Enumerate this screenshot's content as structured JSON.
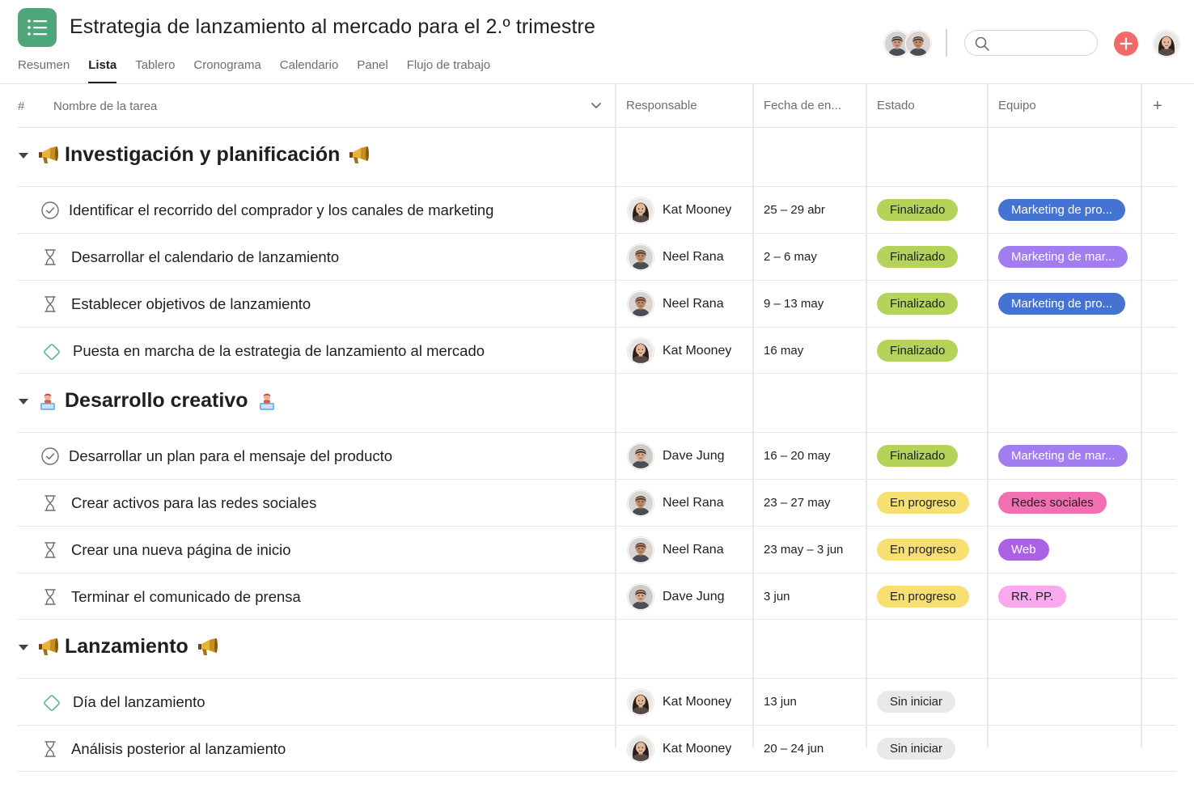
{
  "project": {
    "title": "Estrategia de lanzamiento al mercado para el 2.º trimestre",
    "icon": "list-icon",
    "accent": "#4fa67a"
  },
  "tabs": [
    "Resumen",
    "Lista",
    "Tablero",
    "Cronograma",
    "Calendario",
    "Panel",
    "Flujo de trabajo"
  ],
  "active_tab": "Lista",
  "toolbar": {
    "search_placeholder": "",
    "add_color": "#f06a6a"
  },
  "columns": {
    "number": "#",
    "task": "Nombre de la tarea",
    "assignee": "Responsable",
    "due": "Fecha de en...",
    "status": "Estado",
    "team": "Equipo"
  },
  "colors": {
    "Finalizado": {
      "bg": "#b5d35a",
      "fg": "#1e1f21"
    },
    "En progreso": {
      "bg": "#f8df72",
      "fg": "#1e1f21"
    },
    "Sin iniciar": {
      "bg": "#e9e9e9",
      "fg": "#1e1f21"
    },
    "Marketing de pro...": {
      "bg": "#4573d2",
      "fg": "#ffffff"
    },
    "Marketing de mar...": {
      "bg": "#a17df0",
      "fg": "#ffffff"
    },
    "Redes sociales": {
      "bg": "#f26fb2",
      "fg": "#1e1f21"
    },
    "Web": {
      "bg": "#aa62e3",
      "fg": "#ffffff"
    },
    "RR. PP.": {
      "bg": "#f9aaef",
      "fg": "#1e1f21"
    }
  },
  "sections": [
    {
      "title": "Investigación y planificación",
      "emoji": "megaphone-icon",
      "tasks": [
        {
          "icon": "check-circle-icon",
          "name": "Identificar el recorrido del comprador y los canales de marketing",
          "assignee": "Kat Mooney",
          "date": "25 – 29 abr",
          "status": "Finalizado",
          "team": "Marketing de pro..."
        },
        {
          "icon": "hourglass-icon",
          "name": "Desarrollar el calendario de lanzamiento",
          "assignee": "Neel Rana",
          "date": "2 – 6 may",
          "status": "Finalizado",
          "team": "Marketing de mar..."
        },
        {
          "icon": "hourglass-icon",
          "name": "Establecer objetivos de lanzamiento",
          "assignee": "Neel Rana",
          "date": "9 – 13 may",
          "status": "Finalizado",
          "team": "Marketing de pro..."
        },
        {
          "icon": "milestone-diamond-icon",
          "name": "Puesta en marcha de la estrategia de lanzamiento al mercado",
          "assignee": "Kat Mooney",
          "date": "16 may",
          "status": "Finalizado",
          "team": ""
        }
      ]
    },
    {
      "title": "Desarrollo creativo",
      "emoji": "artist-icon",
      "tasks": [
        {
          "icon": "check-circle-icon",
          "name": "Desarrollar un plan para el mensaje del producto",
          "assignee": "Dave Jung",
          "date": "16 – 20 may",
          "status": "Finalizado",
          "team": "Marketing de mar..."
        },
        {
          "icon": "hourglass-icon",
          "name": "Crear activos para las redes sociales",
          "assignee": "Neel Rana",
          "date": "23 – 27 may",
          "status": "En progreso",
          "team": "Redes sociales"
        },
        {
          "icon": "hourglass-icon",
          "name": "Crear una nueva página de inicio",
          "assignee": "Neel Rana",
          "date": "23 may – 3 jun",
          "status": "En progreso",
          "team": "Web"
        },
        {
          "icon": "hourglass-icon",
          "name": "Terminar el comunicado de prensa",
          "assignee": "Dave Jung",
          "date": "3 jun",
          "status": "En progreso",
          "team": "RR. PP."
        }
      ]
    },
    {
      "title": "Lanzamiento",
      "emoji": "megaphone-icon",
      "tasks": [
        {
          "icon": "milestone-diamond-icon",
          "name": "Día del lanzamiento",
          "assignee": "Kat Mooney",
          "date": "13 jun",
          "status": "Sin iniciar",
          "team": ""
        },
        {
          "icon": "hourglass-icon",
          "name": "Análisis posterior al lanzamiento",
          "assignee": "Kat Mooney",
          "date": "20 – 24 jun",
          "status": "Sin iniciar",
          "team": ""
        }
      ]
    }
  ]
}
